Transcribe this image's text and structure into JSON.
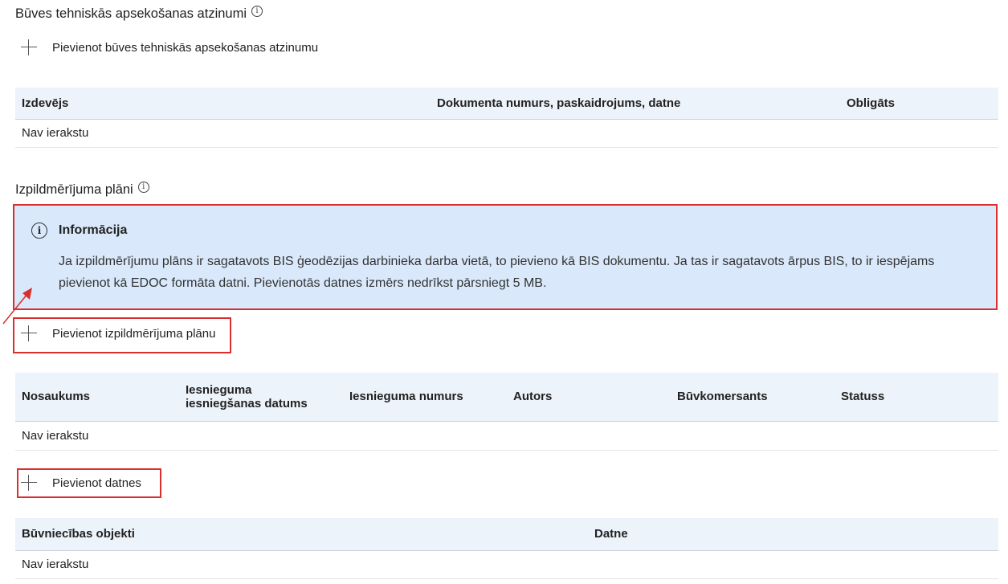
{
  "section1": {
    "title": "Būves tehniskās apsekošanas atzinumi",
    "add_label": "Pievienot būves tehniskās apsekošanas atzinumu",
    "table": {
      "headers": [
        "Izdevējs",
        "Dokumenta numurs, paskaidrojums, datne",
        "Obligāts"
      ],
      "empty_text": "Nav ierakstu"
    }
  },
  "section2": {
    "title": "Izpildmērījuma plāni",
    "info": {
      "title": "Informācija",
      "text": "Ja izpildmērījumu plāns ir sagatavots BIS ģeodēzijas darbinieka darba vietā, to pievieno kā BIS dokumentu. Ja tas ir sagatavots ārpus BIS, to ir iespējams pievienot kā EDOC formāta datni. Pievienotās datnes izmērs nedrīkst pārsniegt 5 MB."
    },
    "add_label": "Pievienot izpildmērījuma plānu",
    "table": {
      "headers": [
        "Nosaukums",
        "Iesnieguma iesniegšanas datums",
        "Iesnieguma numurs",
        "Autors",
        "Būvkomersants",
        "Statuss"
      ],
      "empty_text": "Nav ierakstu"
    }
  },
  "section3": {
    "add_label": "Pievienot datnes",
    "table": {
      "headers": [
        "Būvniecības objekti",
        "Datne"
      ],
      "empty_text": "Nav ierakstu"
    }
  },
  "colors": {
    "highlight_red": "#d9302c",
    "info_bg": "#d9e8fa",
    "table_header_bg": "#edf3fa"
  },
  "icons": {
    "info": "info-icon",
    "add": "plus-icon",
    "annotation": "arrow-icon"
  }
}
